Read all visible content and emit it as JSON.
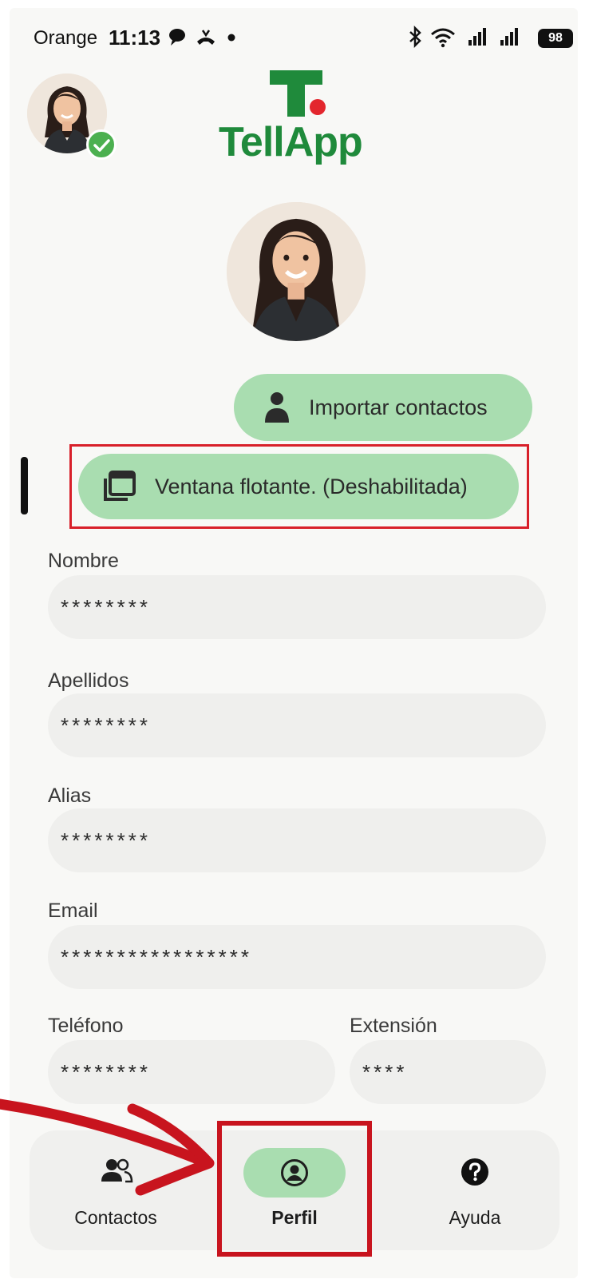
{
  "status_bar": {
    "carrier": "Orange",
    "time": "11:13",
    "battery": "98"
  },
  "header": {
    "logo_text": "TellApp"
  },
  "actions": {
    "import_contacts": "Importar contactos",
    "floating_window": "Ventana flotante. (Deshabilitada)"
  },
  "form": {
    "nombre": {
      "label": "Nombre",
      "value": "********"
    },
    "apellidos": {
      "label": "Apellidos",
      "value": "********"
    },
    "alias": {
      "label": "Alias",
      "value": "********"
    },
    "email": {
      "label": "Email",
      "value": "*****************"
    },
    "telefono": {
      "label": "Teléfono",
      "value": "********"
    },
    "extension": {
      "label": "Extensión",
      "value": "****"
    }
  },
  "bottom_nav": {
    "items": [
      {
        "label": "Contactos",
        "icon": "people-icon"
      },
      {
        "label": "Perfil",
        "icon": "profile-circle-icon",
        "active": true
      },
      {
        "label": "Ayuda",
        "icon": "help-icon"
      }
    ]
  },
  "colors": {
    "brand_green": "#1f8a3b",
    "brand_red": "#e3262d",
    "pill_green": "#a9ddb0",
    "annotation_red": "#c8141e"
  }
}
